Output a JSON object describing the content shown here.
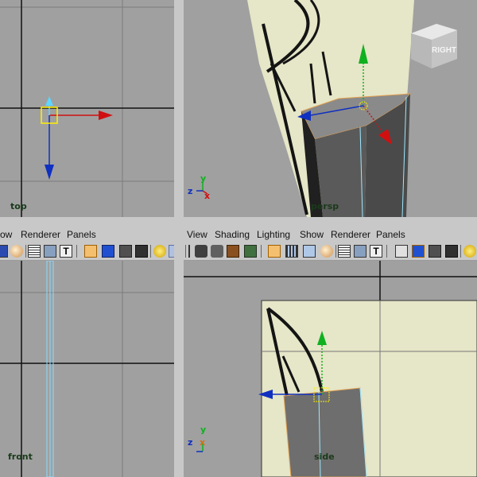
{
  "viewports": {
    "top": {
      "label": "top"
    },
    "persp": {
      "label": "persp"
    },
    "front": {
      "label": "front"
    },
    "side": {
      "label": "side"
    }
  },
  "view_cube": {
    "face_label": "RIGHT"
  },
  "axis_indicator": {
    "x": "x",
    "y": "y",
    "z": "z"
  },
  "panel_menu_left": {
    "items": [
      "ow",
      "Renderer",
      "Panels"
    ]
  },
  "panel_menu_right": {
    "items": [
      "View",
      "Shading",
      "Lighting",
      "Show",
      "Renderer",
      "Panels"
    ]
  },
  "icons_left_toolbar": [
    "blue-shade-icon",
    "ball-icon",
    "wire-grid-icon",
    "smooth-grid-icon",
    "text-icon",
    "cube-outline-icon",
    "cube-blue-icon",
    "cube-dark-icon",
    "cube-shadow-icon",
    "bulb-icon",
    "light-icon"
  ],
  "icons_right_toolbar": [
    "snap-icon",
    "camera-icon",
    "camera-attr-icon",
    "bookmark-icon",
    "image-plane-icon",
    "grid-toggle-icon",
    "film-gate-icon",
    "resolution-gate-icon",
    "ball-icon",
    "wire-grid-icon",
    "smooth-grid-icon",
    "text-icon",
    "cube-outline-icon",
    "cube-blue-icon",
    "cube-dark-icon",
    "cube-shadow-icon",
    "bulb-icon"
  ],
  "colors": {
    "viewport_bg": "#a0a0a0",
    "panel_bg": "#c8c8c8",
    "image_plane": "#e6e6c8",
    "x_axis": "#d01010",
    "y_axis": "#10b020",
    "z_axis": "#1030c0",
    "selection": "#fff000",
    "outline_highlight": "#88ddff"
  }
}
